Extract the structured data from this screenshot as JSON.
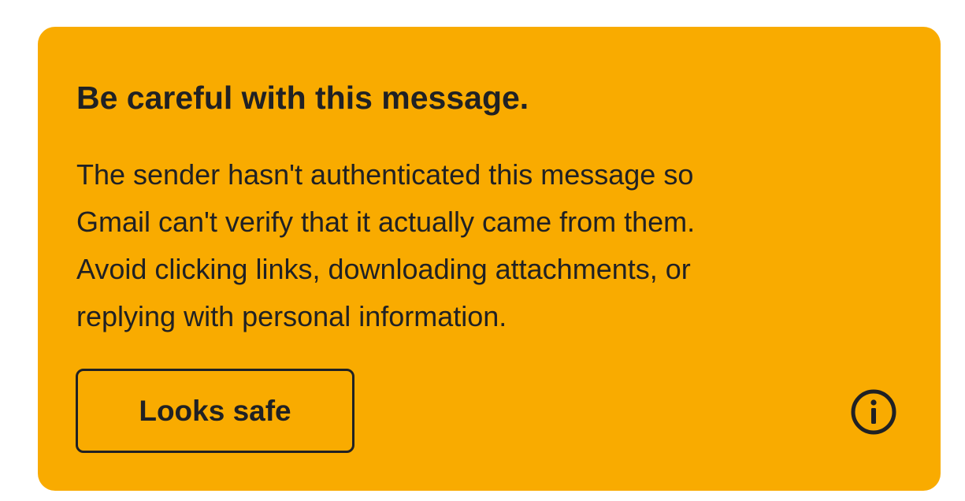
{
  "warning": {
    "title": "Be careful with this message.",
    "body_lines": [
      "The sender hasn't authenticated this message so",
      "Gmail can't verify that it actually came from them.",
      "Avoid clicking links, downloading attachments, or",
      "replying with personal information."
    ],
    "button_label": "Looks safe",
    "info_icon": "info-icon",
    "accent_color": "#f9ab00",
    "text_color": "#202124"
  }
}
